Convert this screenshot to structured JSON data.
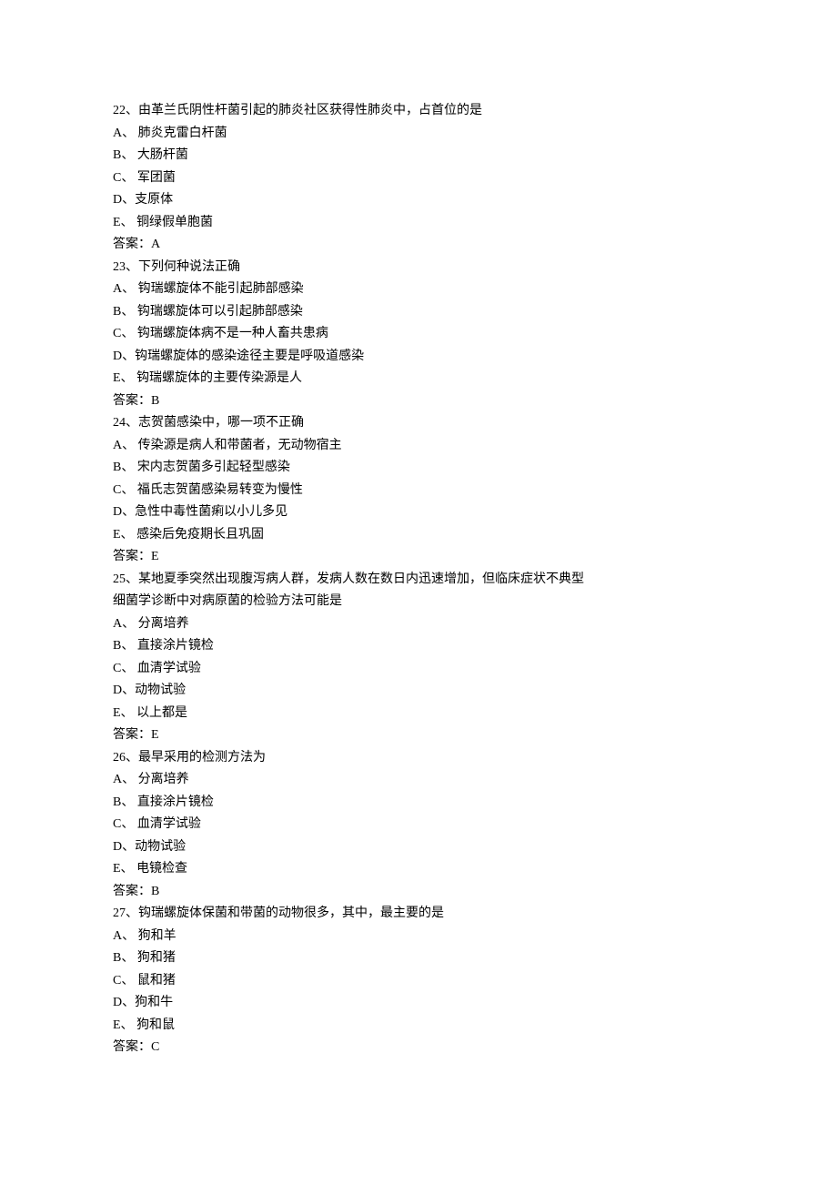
{
  "questions": [
    {
      "number": "22、",
      "text": "由革兰氏阴性杆菌引起的肺炎社区获得性肺炎中，占首位的是",
      "options": [
        {
          "label": "A、  ",
          "text": "肺炎克雷白杆菌"
        },
        {
          "label": "B、  ",
          "text": "大肠杆菌"
        },
        {
          "label": "C、  ",
          "text": "军团菌"
        },
        {
          "label": "D、",
          "text": "支原体"
        },
        {
          "label": "E、  ",
          "text": "铜绿假单胞菌"
        }
      ],
      "answer_label": "答案：",
      "answer": "A"
    },
    {
      "number": "23、",
      "text": "下列何种说法正确",
      "options": [
        {
          "label": "A、  ",
          "text": "钩瑞螺旋体不能引起肺部感染"
        },
        {
          "label": "B、  ",
          "text": "钩瑞螺旋体可以引起肺部感染"
        },
        {
          "label": "C、  ",
          "text": "钩瑞螺旋体病不是一种人畜共患病"
        },
        {
          "label": "D、",
          "text": "钩瑞螺旋体的感染途径主要是呼吸道感染"
        },
        {
          "label": "E、  ",
          "text": "钩瑞螺旋体的主要传染源是人"
        }
      ],
      "answer_label": "答案：",
      "answer": "B"
    },
    {
      "number": "24、",
      "text": "志贺菌感染中，哪一项不正确",
      "options": [
        {
          "label": "A、  ",
          "text": "传染源是病人和带菌者，无动物宿主"
        },
        {
          "label": "B、  ",
          "text": "宋内志贺菌多引起轻型感染"
        },
        {
          "label": "C、  ",
          "text": "福氏志贺菌感染易转变为慢性"
        },
        {
          "label": "D、",
          "text": "急性中毒性菌痢以小儿多见"
        },
        {
          "label": "E、  ",
          "text": "感染后免疫期长且巩固"
        }
      ],
      "answer_label": "答案：",
      "answer": "E"
    },
    {
      "number": "25、",
      "text": "某地夏季突然出现腹泻病人群，发病人数在数日内迅速增加，但临床症状不典型",
      "text_line2": "细菌学诊断中对病原菌的检验方法可能是",
      "options": [
        {
          "label": "A、  ",
          "text": "分离培养"
        },
        {
          "label": "B、  ",
          "text": "直接涂片镜检"
        },
        {
          "label": "C、  ",
          "text": "血清学试验"
        },
        {
          "label": "D、",
          "text": "动物试验"
        },
        {
          "label": "E、  ",
          "text": "以上都是"
        }
      ],
      "answer_label": "答案：",
      "answer": "E"
    },
    {
      "number": "26、",
      "text": "最早采用的检测方法为",
      "options": [
        {
          "label": "A、  ",
          "text": "分离培养"
        },
        {
          "label": "B、  ",
          "text": "直接涂片镜检"
        },
        {
          "label": "C、  ",
          "text": "血清学试验"
        },
        {
          "label": "D、",
          "text": "动物试验"
        },
        {
          "label": "E、  ",
          "text": "电镜检查"
        }
      ],
      "answer_label": "答案：",
      "answer": "B"
    },
    {
      "number": "27、",
      "text": "钩瑞螺旋体保菌和带菌的动物很多，其中，最主要的是",
      "options": [
        {
          "label": "A、  ",
          "text": "狗和羊"
        },
        {
          "label": "B、  ",
          "text": "狗和猪"
        },
        {
          "label": "C、  ",
          "text": "鼠和猪"
        },
        {
          "label": "D、",
          "text": "狗和牛"
        },
        {
          "label": "E、  ",
          "text": "狗和鼠"
        }
      ],
      "answer_label": "答案：",
      "answer": "C"
    }
  ]
}
